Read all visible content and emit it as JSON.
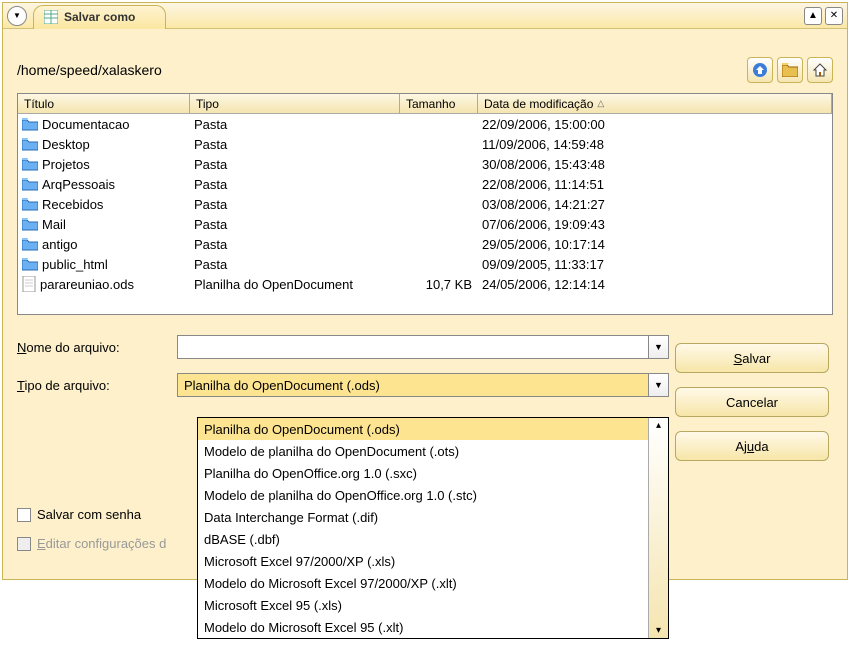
{
  "window": {
    "title": "Salvar como"
  },
  "path": "/home/speed/xalaskero",
  "table": {
    "headers": {
      "title": "Título",
      "type": "Tipo",
      "size": "Tamanho",
      "date": "Data de modificação"
    },
    "rows": [
      {
        "icon": "folder",
        "title": "Documentacao",
        "type": "Pasta",
        "size": "",
        "date": "22/09/2006, 15:00:00"
      },
      {
        "icon": "folder",
        "title": "Desktop",
        "type": "Pasta",
        "size": "",
        "date": "11/09/2006, 14:59:48"
      },
      {
        "icon": "folder",
        "title": "Projetos",
        "type": "Pasta",
        "size": "",
        "date": "30/08/2006, 15:43:48"
      },
      {
        "icon": "folder",
        "title": "ArqPessoais",
        "type": "Pasta",
        "size": "",
        "date": "22/08/2006, 11:14:51"
      },
      {
        "icon": "folder",
        "title": "Recebidos",
        "type": "Pasta",
        "size": "",
        "date": "03/08/2006, 14:21:27"
      },
      {
        "icon": "folder",
        "title": "Mail",
        "type": "Pasta",
        "size": "",
        "date": "07/06/2006, 19:09:43"
      },
      {
        "icon": "folder",
        "title": "antigo",
        "type": "Pasta",
        "size": "",
        "date": "29/05/2006, 10:17:14"
      },
      {
        "icon": "folder",
        "title": "public_html",
        "type": "Pasta",
        "size": "",
        "date": "09/09/2005, 11:33:17"
      },
      {
        "icon": "file",
        "title": "parareuniao.ods",
        "type": "Planilha do OpenDocument",
        "size": "10,7 KB",
        "date": "24/05/2006, 12:14:14"
      }
    ]
  },
  "form": {
    "filename_label": "Nome do arquivo:",
    "filename_value": "",
    "filetype_label": "Tipo de arquivo:",
    "filetype_selected": "Planilha do OpenDocument (.ods)",
    "filetype_options": [
      "Planilha do OpenDocument (.ods)",
      "Modelo de planilha do OpenDocument (.ots)",
      "Planilha do OpenOffice.org 1.0 (.sxc)",
      "Modelo de planilha do OpenOffice.org 1.0 (.stc)",
      "Data Interchange Format (.dif)",
      "dBASE (.dbf)",
      "Microsoft Excel 97/2000/XP (.xls)",
      "Modelo do Microsoft Excel 97/2000/XP (.xlt)",
      "Microsoft Excel 95 (.xls)",
      "Modelo do Microsoft Excel 95 (.xlt)"
    ],
    "save_with_password": "Salvar com senha",
    "edit_filter_settings": "Editar configurações"
  },
  "buttons": {
    "save": "Salvar",
    "cancel": "Cancelar",
    "help": "Ajuda"
  },
  "icons": {
    "up": "up-arrow-icon",
    "new_folder": "new-folder-icon",
    "home": "home-icon"
  }
}
